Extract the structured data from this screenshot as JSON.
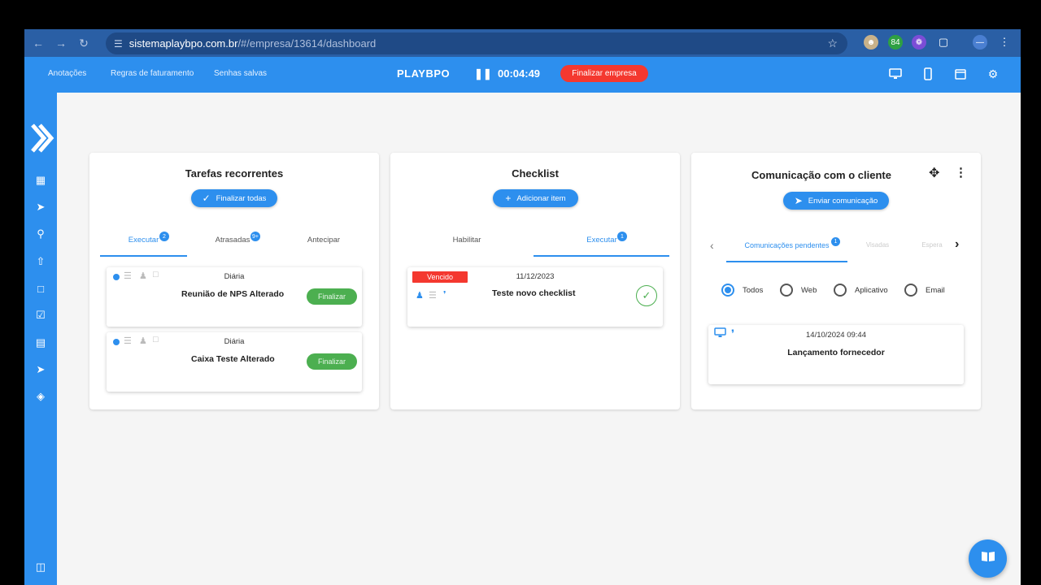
{
  "browser": {
    "url_host": "sistemaplaybpo.com.br",
    "url_path": "/#/empresa/13614/dashboard",
    "ext_badge": "84"
  },
  "header": {
    "links": [
      "Anotações",
      "Regras de faturamento",
      "Senhas salvas"
    ],
    "brand": "PLAYBPO",
    "timer": "00:04:49",
    "finalize_company": "Finalizar empresa"
  },
  "tarefas": {
    "title": "Tarefas recorrentes",
    "finalize_all": "Finalizar todas",
    "tabs": [
      {
        "label": "Executar",
        "badge": "2"
      },
      {
        "label": "Atrasadas",
        "badge": "9+"
      },
      {
        "label": "Antecipar",
        "badge": ""
      }
    ],
    "items": [
      {
        "frequency": "Diária",
        "name": "Reunião de NPS Alterado",
        "action": "Finalizar"
      },
      {
        "frequency": "Diária",
        "name": "Caixa Teste Alterado",
        "action": "Finalizar"
      }
    ]
  },
  "checklist": {
    "title": "Checklist",
    "add_item": "Adicionar item",
    "tabs": [
      {
        "label": "Habilitar",
        "badge": ""
      },
      {
        "label": "Executar",
        "badge": "1"
      }
    ],
    "items": [
      {
        "status": "Vencido",
        "date": "11/12/2023",
        "name": "Teste novo checklist"
      }
    ]
  },
  "comunicacao": {
    "title": "Comunicação com o cliente",
    "send": "Enviar comunicação",
    "tabs": [
      {
        "label": "Comunicações pendentes",
        "badge": "1"
      },
      {
        "label": "Visadas",
        "badge": ""
      },
      {
        "label": "Espera",
        "badge": ""
      }
    ],
    "filters": [
      "Todos",
      "Web",
      "Aplicativo",
      "Email"
    ],
    "selected_filter": "Todos",
    "items": [
      {
        "datetime": "14/10/2024 09:44",
        "name": "Lançamento fornecedor"
      }
    ]
  },
  "colors": {
    "primary": "#2d8fee",
    "danger": "#f4382f",
    "success": "#4caf50",
    "browser": "#2a5fa5"
  }
}
